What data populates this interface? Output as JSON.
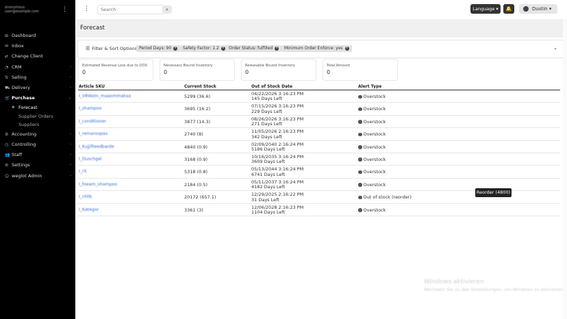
{
  "sidebar": {
    "user_name": "anonymous",
    "user_email": "user@example.com",
    "items": [
      {
        "label": "Dashboard",
        "icon": "dashboard-icon",
        "glyph": "⊞",
        "chev": false
      },
      {
        "label": "Inbox",
        "icon": "inbox-icon",
        "glyph": "✉",
        "chev": false
      },
      {
        "label": "Change Client",
        "icon": "switch-icon",
        "glyph": "⇄",
        "chev": false
      },
      {
        "label": "CRM",
        "icon": "crm-icon",
        "glyph": "◔",
        "chev": true
      },
      {
        "label": "Selling",
        "icon": "selling-icon",
        "glyph": "⇅",
        "chev": true
      },
      {
        "label": "Delivery",
        "icon": "truck-icon",
        "glyph": "⛟",
        "chev": true
      },
      {
        "label": "Purchase",
        "icon": "cart-icon",
        "glyph": "🛒",
        "chev": true,
        "active": true
      }
    ],
    "subitems": [
      {
        "label": "Forecast",
        "icon": "forecast-icon",
        "glyph": "≋",
        "active": true
      },
      {
        "label": "Supplier Orders",
        "icon": "",
        "glyph": "",
        "active": false
      },
      {
        "label": "Suppliers",
        "icon": "",
        "glyph": "",
        "active": false
      }
    ],
    "items2": [
      {
        "label": "Accounting",
        "icon": "accounting-icon",
        "glyph": "⚙",
        "chev": true
      },
      {
        "label": "Controlling",
        "icon": "controlling-icon",
        "glyph": "◷",
        "chev": true
      },
      {
        "label": "Staff",
        "icon": "staff-icon",
        "glyph": "👥",
        "chev": true
      },
      {
        "label": "Settings",
        "icon": "gear-icon",
        "glyph": "⚙",
        "chev": true
      },
      {
        "label": "weglot Admin",
        "icon": "admin-icon",
        "glyph": "☺",
        "chev": true
      }
    ]
  },
  "topbar": {
    "search_placeholder": "Search",
    "language_label": "Language ▾",
    "user_label": "Dustin ▾"
  },
  "page": {
    "title": "Forecast"
  },
  "filters": {
    "label": "Filter & Sort Options",
    "chips": [
      "Period Days: 90",
      "Safety Factor: 1.2",
      "Order Status: fulfilled",
      "Minimum Order Enforce: yes"
    ]
  },
  "cards": [
    {
      "label": "Estimated Revenue Loss due to OOS",
      "value": "0"
    },
    {
      "label": "Necessary Bound Inventory",
      "value": "0"
    },
    {
      "label": "Releasable Bound Inventory",
      "value": "0"
    },
    {
      "label": "Total Amount",
      "value": "0"
    }
  ],
  "table": {
    "headers": [
      "Article SKU",
      "Current Stock",
      "Out of Stock Date",
      "Alert Type"
    ],
    "rows": [
      {
        "sku": "I_V8Watn_maaommaksa",
        "stock": "5299 (36.6)",
        "date": "04/22/2026 3:16:23 PM",
        "days": "145 Days Left",
        "alert": "Overstock"
      },
      {
        "sku": "I_shampoo",
        "stock": "3695 (16.2)",
        "date": "07/15/2026 3:16:23 PM",
        "days": "229 Days Left",
        "alert": "Overstock"
      },
      {
        "sku": "I_conditioner",
        "stock": "3877 (14.3)",
        "date": "08/26/2026 3:16:23 PM",
        "days": "271 Days Left",
        "alert": "Overstock"
      },
      {
        "sku": "I_remanoqsss",
        "stock": "2740 (8)",
        "date": "11/05/2026 2:16:23 PM",
        "days": "342 Days Left",
        "alert": "Overstock"
      },
      {
        "sku": "I_Kujjifteedbarde",
        "stock": "4840 (0.9)",
        "date": "02/09/2040 2:16:24 PM",
        "days": "5186 Days Left",
        "alert": "Overstock"
      },
      {
        "sku": "I_Duschgel",
        "stock": "3168 (0.9)",
        "date": "10/16/2035 3:16:24 PM",
        "days": "3609 Days Left",
        "alert": "Overstock"
      },
      {
        "sku": "I_rit",
        "stock": "5318 (0.8)",
        "date": "05/13/2044 3:16:24 PM",
        "days": "6741 Days Left",
        "alert": "Overstock"
      },
      {
        "sku": "I_foeam_shampoo",
        "stock": "2184 (0.5)",
        "date": "05/11/2037 3:16:24 PM",
        "days": "4182 Days Left",
        "alert": "Overstock"
      },
      {
        "sku": "I_nhtb",
        "stock": "20172 (657.1)",
        "date": "12/29/2025 2:16:22 PM",
        "days": "31 Days Left",
        "alert": "Out of stock (reorder)"
      },
      {
        "sku": "I_Kategor",
        "stock": "3361 (3)",
        "date": "12/06/2028 2:16:23 PM",
        "days": "1104 Days Left",
        "alert": "Overstock"
      }
    ]
  },
  "reorder_label": "Reorder (4800)",
  "watermark": {
    "line1": "Windows aktivieren",
    "line2": "Wechseln Sie zu den Einstellungen, um Windows zu aktivieren."
  }
}
